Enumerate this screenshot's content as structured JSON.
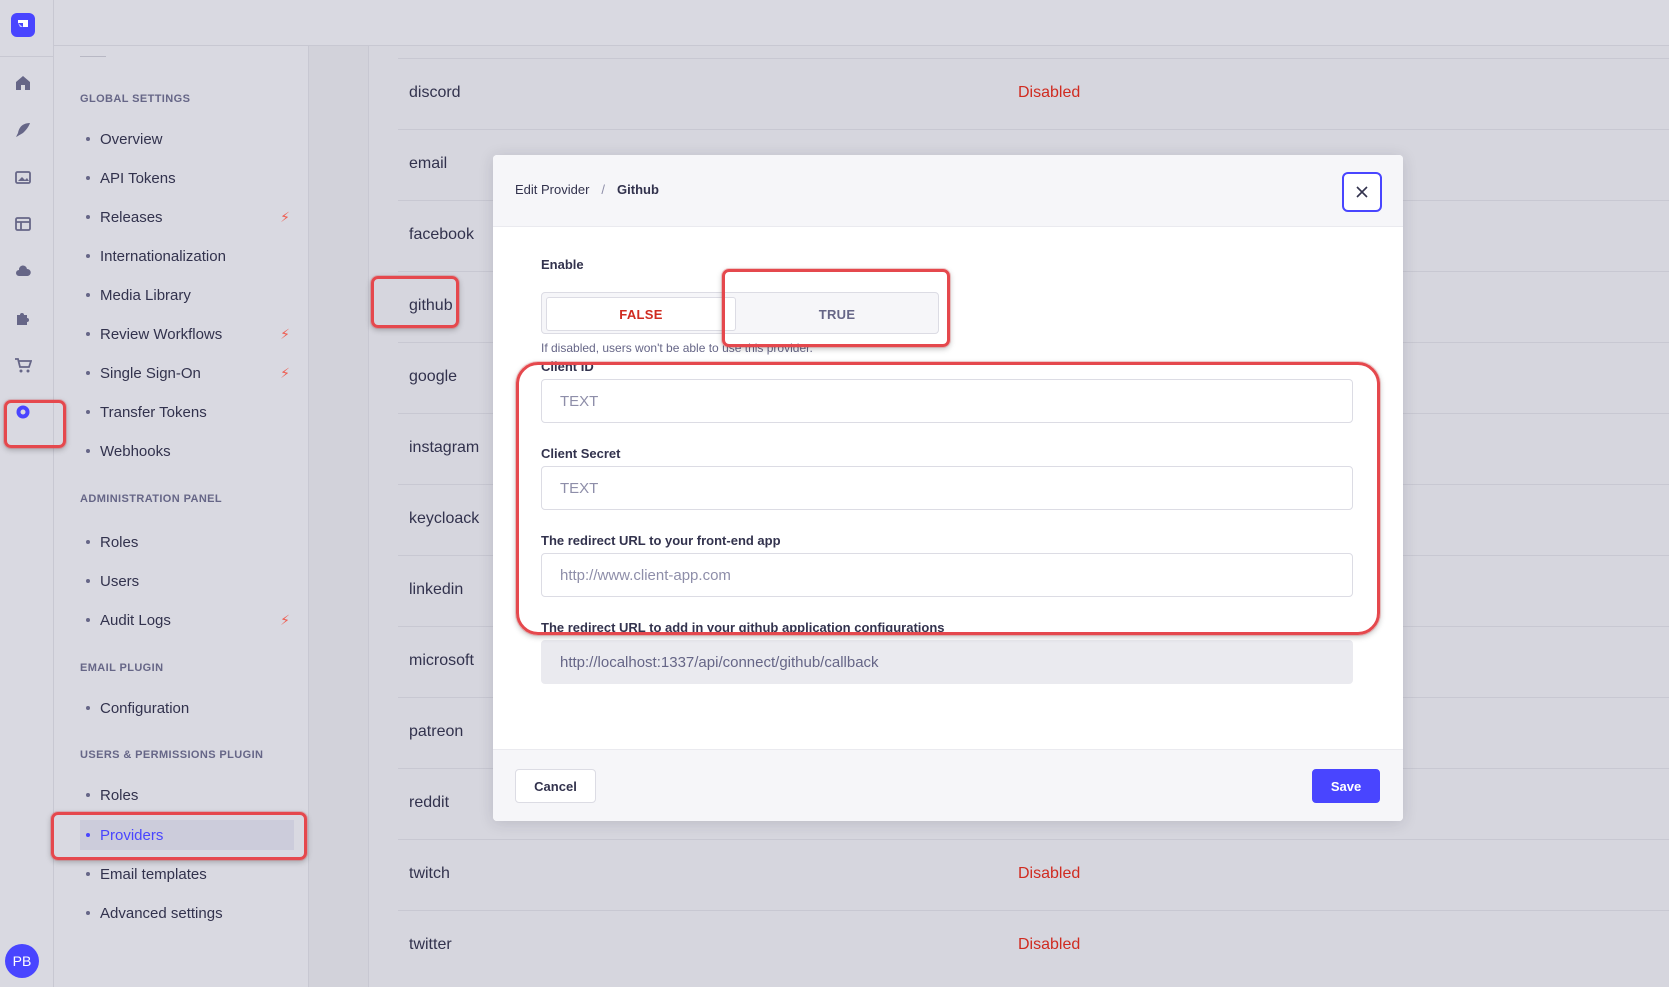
{
  "colors": {
    "accent": "#4945ff",
    "danger": "#d02b20",
    "highlight": "#e5484d",
    "bolt": "#ee5e52"
  },
  "rail": {
    "icons": [
      "logo-icon",
      "home-icon",
      "feather-icon",
      "media-icon",
      "layout-icon",
      "cloud-icon",
      "puzzle-icon",
      "cart-icon",
      "settings-icon"
    ],
    "avatar_initials": "PB"
  },
  "subnav": {
    "sections": [
      {
        "title": "GLOBAL SETTINGS",
        "items": [
          {
            "label": "Overview"
          },
          {
            "label": "API Tokens"
          },
          {
            "label": "Releases",
            "bolt": true
          },
          {
            "label": "Internationalization"
          },
          {
            "label": "Media Library"
          },
          {
            "label": "Review Workflows",
            "bolt": true
          },
          {
            "label": "Single Sign-On",
            "bolt": true
          },
          {
            "label": "Transfer Tokens"
          },
          {
            "label": "Webhooks"
          }
        ]
      },
      {
        "title": "ADMINISTRATION PANEL",
        "items": [
          {
            "label": "Roles"
          },
          {
            "label": "Users"
          },
          {
            "label": "Audit Logs",
            "bolt": true
          }
        ]
      },
      {
        "title": "EMAIL PLUGIN",
        "items": [
          {
            "label": "Configuration"
          }
        ]
      },
      {
        "title": "USERS & PERMISSIONS PLUGIN",
        "items": [
          {
            "label": "Roles"
          },
          {
            "label": "Providers",
            "active": true
          },
          {
            "label": "Email templates"
          },
          {
            "label": "Advanced settings"
          }
        ]
      }
    ]
  },
  "providers": [
    {
      "name": "discord",
      "status": "Disabled"
    },
    {
      "name": "email",
      "status": ""
    },
    {
      "name": "facebook",
      "status": ""
    },
    {
      "name": "github",
      "status": ""
    },
    {
      "name": "google",
      "status": ""
    },
    {
      "name": "instagram",
      "status": ""
    },
    {
      "name": "keycloack",
      "status": ""
    },
    {
      "name": "linkedin",
      "status": ""
    },
    {
      "name": "microsoft",
      "status": ""
    },
    {
      "name": "patreon",
      "status": ""
    },
    {
      "name": "reddit",
      "status": ""
    },
    {
      "name": "twitch",
      "status": "Disabled"
    },
    {
      "name": "twitter",
      "status": "Disabled"
    }
  ],
  "modal": {
    "breadcrumb": {
      "parent": "Edit Provider",
      "separator": "/",
      "current": "Github"
    },
    "close_icon": "close-icon",
    "enable": {
      "label": "Enable",
      "false_label": "FALSE",
      "true_label": "TRUE",
      "hint": "If disabled, users won't be able to use this provider."
    },
    "client_id": {
      "label": "Client ID",
      "placeholder": "TEXT"
    },
    "client_secret": {
      "label": "Client Secret",
      "placeholder": "TEXT"
    },
    "redirect_front": {
      "label": "The redirect URL to your front-end app",
      "placeholder": "http://www.client-app.com"
    },
    "redirect_config": {
      "label": "The redirect URL to add in your github application configurations",
      "value": "http://localhost:1337/api/connect/github/callback"
    },
    "cancel_label": "Cancel",
    "save_label": "Save"
  }
}
